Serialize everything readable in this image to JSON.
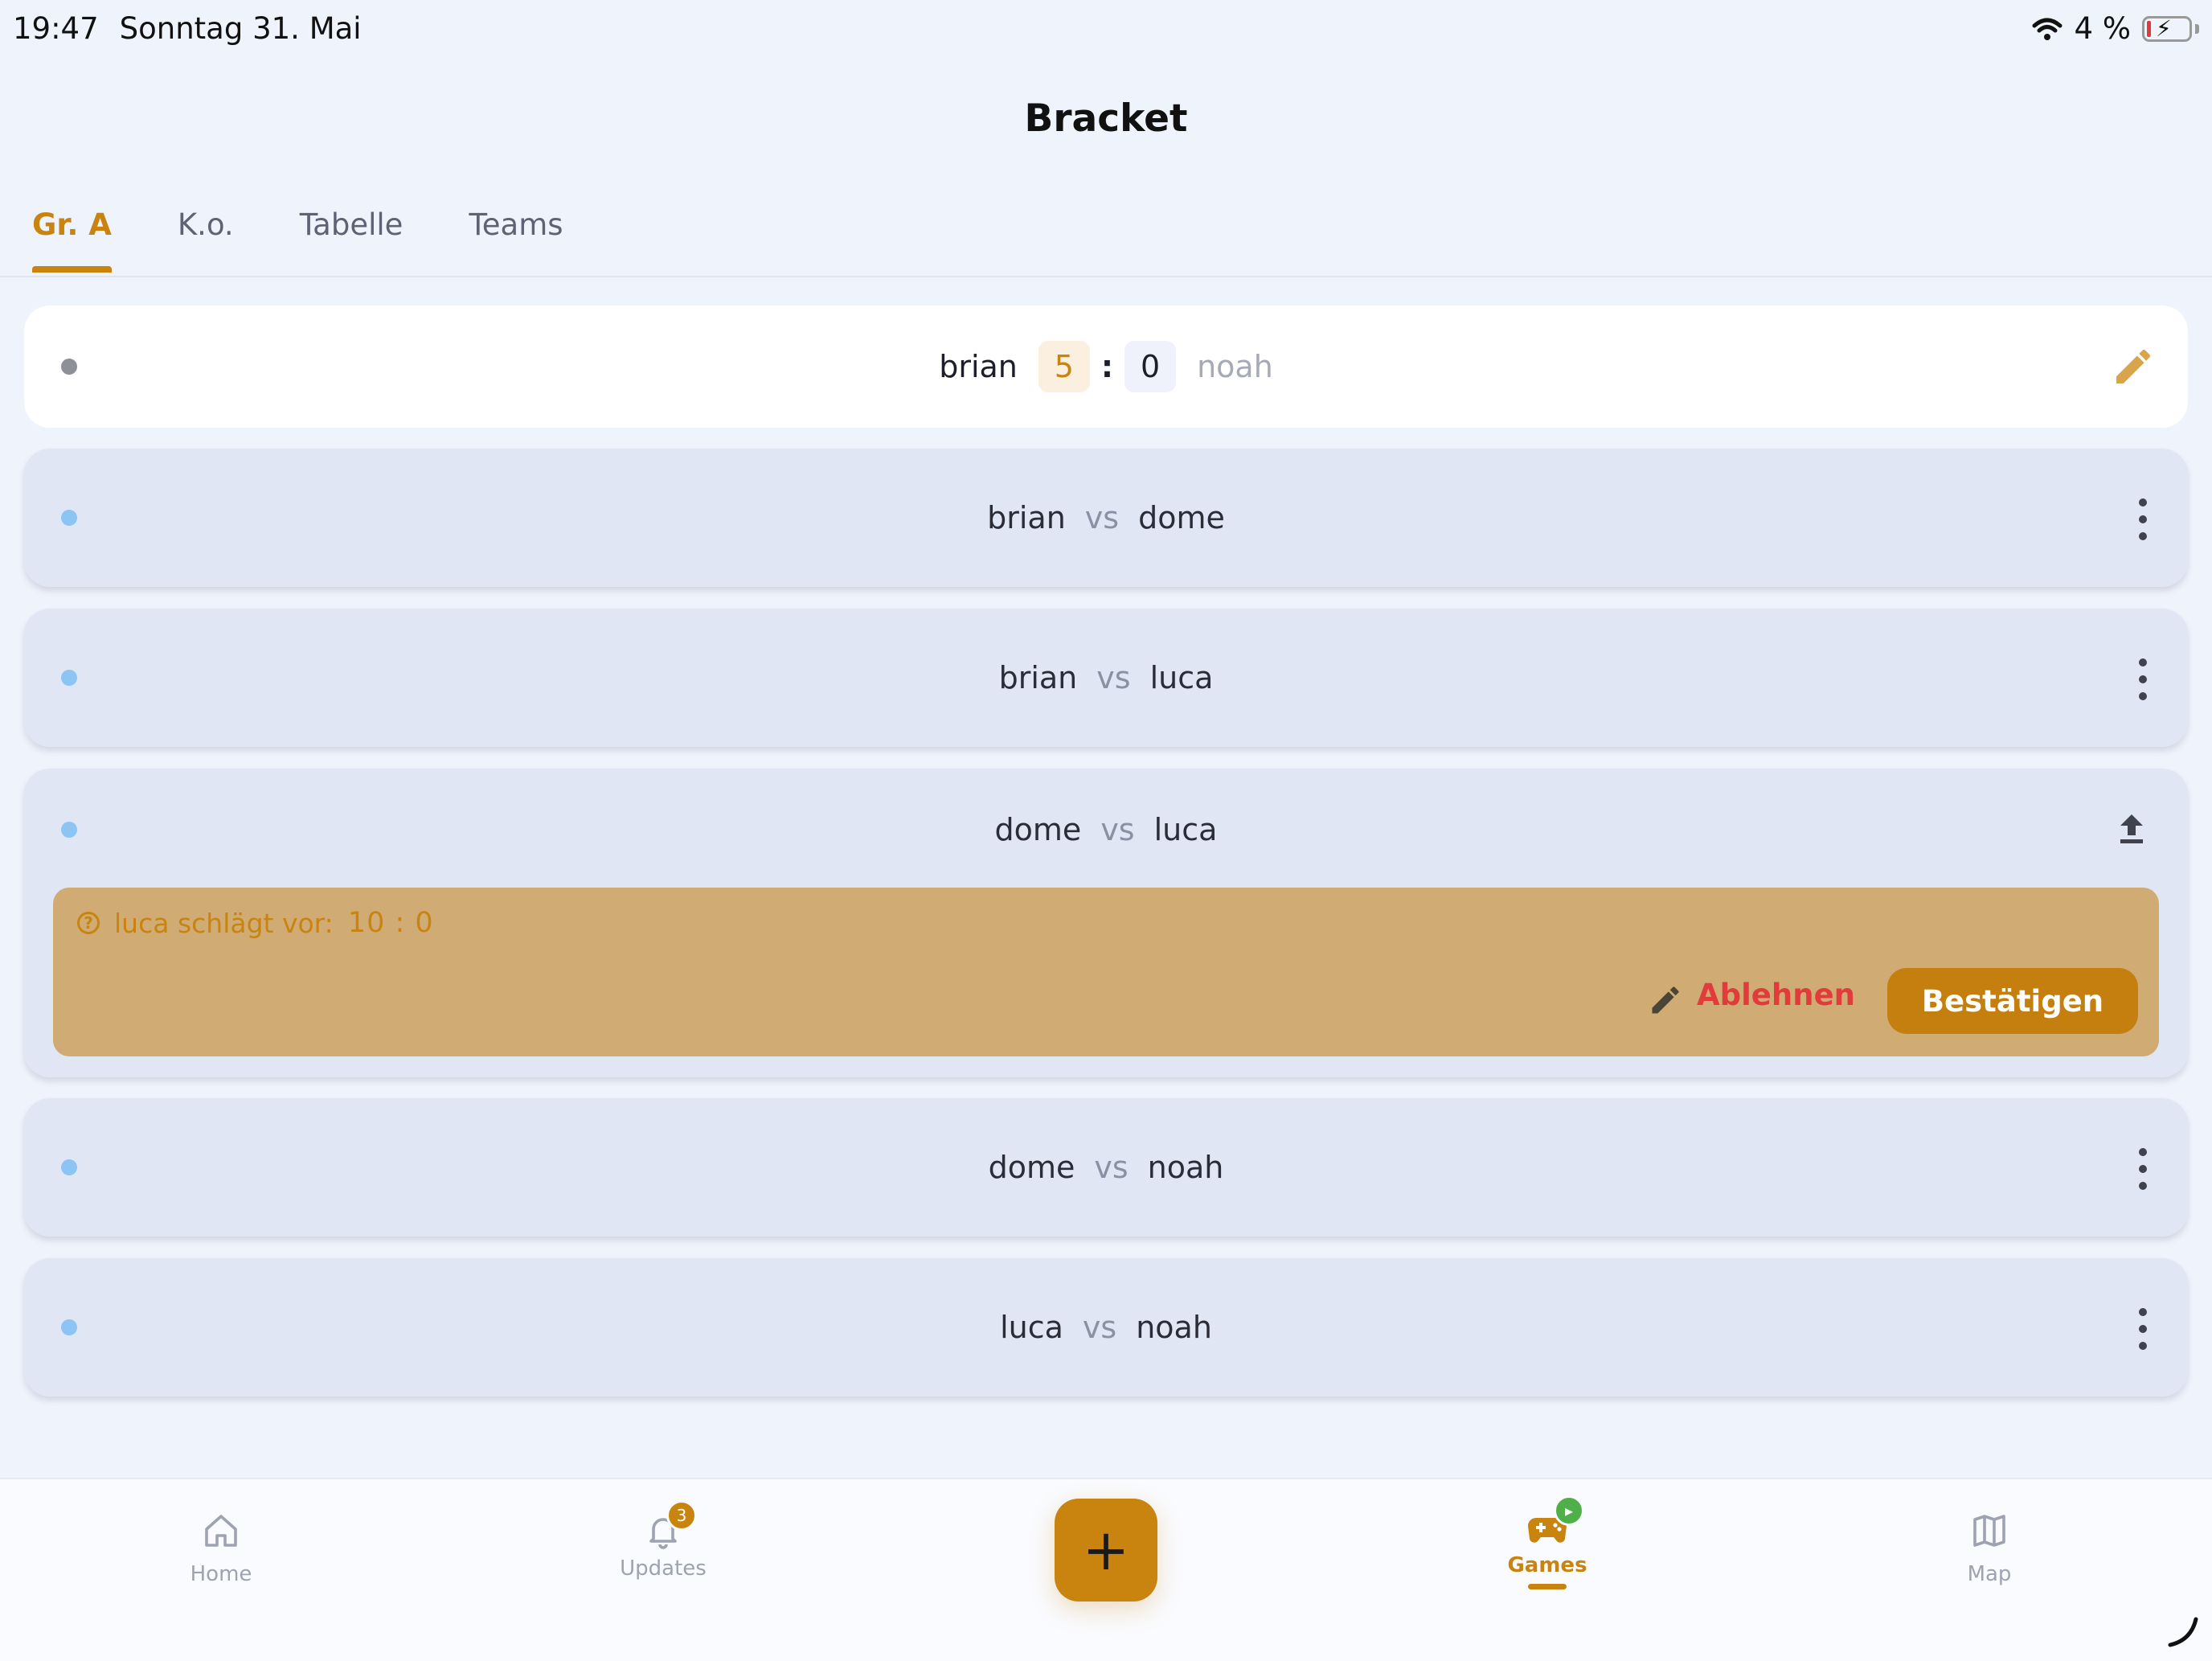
{
  "status_bar": {
    "time": "19:47",
    "date": "Sonntag 31. Mai",
    "battery": "4 %"
  },
  "header": {
    "title": "Bracket"
  },
  "tabs": [
    {
      "label": "Gr. A",
      "active": true
    },
    {
      "label": "K.o.",
      "active": false
    },
    {
      "label": "Tabelle",
      "active": false
    },
    {
      "label": "Teams",
      "active": false
    }
  ],
  "matches": [
    {
      "home": "brian",
      "away": "noah",
      "home_score": "5",
      "away_score": "0",
      "status": "finished"
    },
    {
      "home": "brian",
      "vs": "vs",
      "away": "dome"
    },
    {
      "home": "brian",
      "vs": "vs",
      "away": "luca"
    },
    {
      "home": "dome",
      "vs": "vs",
      "away": "luca",
      "proposal": {
        "text": "luca schlägt vor:",
        "score": "10 : 0",
        "reject_label": "Ablehnen",
        "confirm_label": "Bestätigen"
      }
    },
    {
      "home": "dome",
      "vs": "vs",
      "away": "noah"
    },
    {
      "home": "luca",
      "vs": "vs",
      "away": "noah"
    }
  ],
  "bottom_nav": {
    "items": [
      {
        "label": "Home",
        "icon": "home-icon"
      },
      {
        "label": "Updates",
        "icon": "bell-icon",
        "badge": "3"
      },
      {
        "label": "Games",
        "icon": "gamepad-icon",
        "active": true
      },
      {
        "label": "Map",
        "icon": "map-icon"
      }
    ],
    "fab_label": "+"
  },
  "colors": {
    "accent": "#c8840f",
    "reject": "#e23b3b",
    "background": "#eff3fc",
    "card": "#e1e6f5",
    "proposal": "#d0ac74"
  }
}
